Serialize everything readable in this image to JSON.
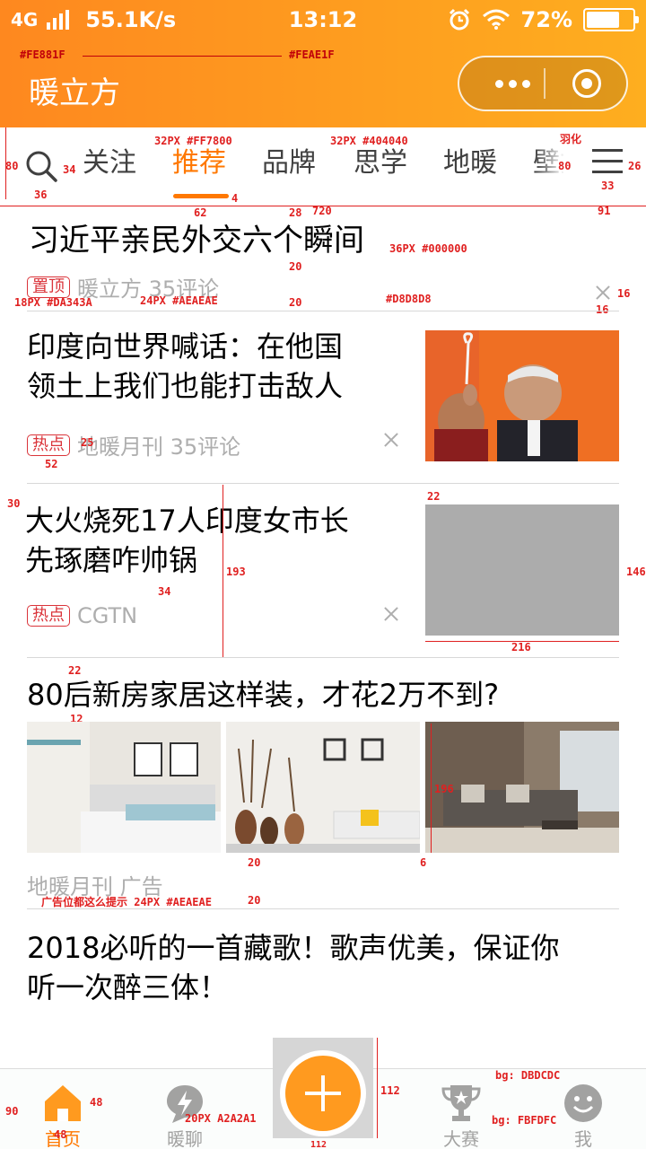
{
  "status": {
    "network": "4G",
    "speed": "55.1K/s",
    "time": "13:12",
    "battery_text": "72%",
    "battery_level": 0.72
  },
  "header": {
    "title": "暖立方",
    "gradient_start": "#FE881F",
    "gradient_end": "#FEAE1F",
    "anno_start": "#FE881F",
    "anno_end": "#FEAE1F"
  },
  "tabs": {
    "items": [
      "关注",
      "推荐",
      "品牌",
      "思学",
      "地暖",
      "壁挂"
    ],
    "active_index": 1,
    "active_color": "#FF7800",
    "text_color": "#404040",
    "anno_active": "32PX #FF7800",
    "anno_normal": "32PX #404040",
    "anno_more": "羽化"
  },
  "articles": [
    {
      "title": "习近平亲民外交六个瞬间",
      "badge": "置顶",
      "source": "暖立方 35评论",
      "anno_title": "36PX #000000",
      "anno_badge": "18PX #DA343A",
      "anno_meta": "24PX #AEAEAE",
      "anno_divider": "#D8D8D8"
    },
    {
      "title_lines": [
        "印度向世界喊话：在他国",
        "领土上我们也能打击敌人"
      ],
      "badge": "热点",
      "source": "地暖月刊 35评论",
      "image": "photo"
    },
    {
      "title_lines": [
        "大火烧死17人印度女市长",
        "先琢磨咋帅锅"
      ],
      "badge": "热点",
      "source": "CGTN",
      "image": "placeholder"
    },
    {
      "title": "80后新房家居这样装，才花2万不到?",
      "source": "地暖月刊  广告",
      "anno_ad": "广告位都这么提示 24PX #AEAEAE",
      "images": [
        "bedroom",
        "vases",
        "living-room"
      ]
    },
    {
      "title_lines": [
        "2018必听的一首藏歌！歌声优美，保证你",
        "听一次醉三体！"
      ]
    }
  ],
  "measures": {
    "m80": "80",
    "m34": "34",
    "m36": "36",
    "m62": "62",
    "m4": "4",
    "m28": "28",
    "m720": "720",
    "m91": "91",
    "m33": "33",
    "m26": "26",
    "m20a": "20",
    "m20b": "20",
    "m16a": "16",
    "m16b": "16",
    "m25": "25",
    "m52": "52",
    "m30": "30",
    "m22a": "22",
    "m193": "193",
    "m146": "146",
    "m216": "216",
    "m34b": "34",
    "m22b": "22",
    "m12": "12",
    "m196": "196",
    "m20c": "20",
    "m6": "6",
    "m20d": "20",
    "m90": "90",
    "m48a": "48",
    "m48b": "48",
    "m112a": "112",
    "m112b": "112",
    "m80b": "80"
  },
  "bottom_nav": {
    "items": [
      {
        "label": "首页",
        "icon": "home-icon",
        "active": true
      },
      {
        "label": "暖聊",
        "icon": "chat-bolt-icon",
        "active": false
      },
      {
        "label": "大赛",
        "icon": "trophy-icon",
        "active": false
      },
      {
        "label": "我",
        "icon": "smiley-icon",
        "active": false
      }
    ],
    "anno_label": "20PX A2A2A1",
    "anno_bg1": "bg: DBDCDC",
    "anno_bg2": "bg: FBFDFC"
  }
}
